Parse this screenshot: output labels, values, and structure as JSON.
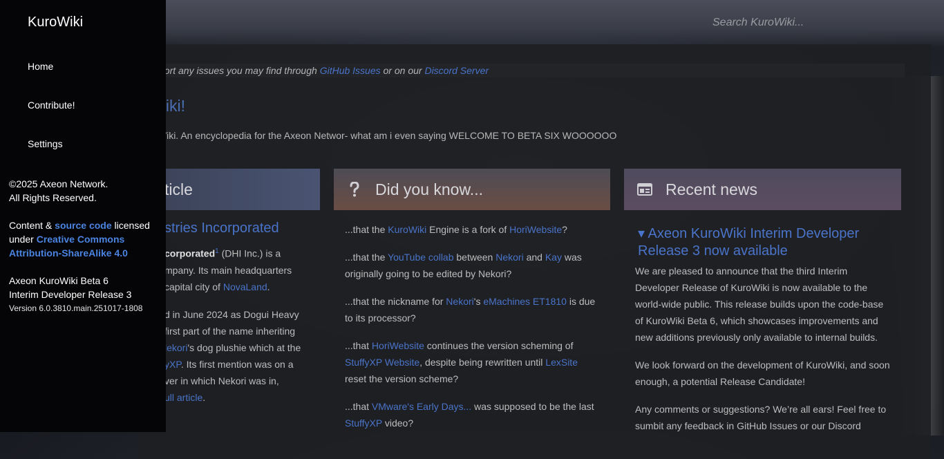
{
  "sidebar": {
    "brand": "KuroWiki",
    "nav": [
      "Home",
      "Contribute!",
      "Settings"
    ],
    "copyright_line1": "©2025 Axeon Network.",
    "copyright_line2": "All Rights Reserved.",
    "license_prefix": "Content & ",
    "license_source": "source code",
    "license_mid1": " licensed",
    "license_under": "under ",
    "license_cc1": "Creative Commons",
    "license_cc2": "Attribution-ShareAlike 4.0",
    "release_line1": "Axeon KuroWiki Beta 6",
    "release_line2": "Interim Developer Release 3",
    "version": "Version 6.0.3810.main.251017-1808"
  },
  "header": {
    "search_placeholder": "Search KuroWiki..."
  },
  "notice": {
    "prefix": "port any issues you may find through ",
    "link1": "GitHub Issues",
    "mid": " or on our ",
    "link2": "Discord Server"
  },
  "welcome": {
    "title": "Viki!",
    "text": "Viki. An encyclopedia for the Axeon Networ- what am i even saying WELCOME TO BETA SIX WOOOOOO"
  },
  "featured": {
    "header": "ticle",
    "title": "stries Incorporated",
    "p1_bold": "corporated",
    "p1_sup": "1",
    "p1_a": " (DHI Inc.) is a",
    "p1_b": "mpany. Its main headquarters",
    "p1_c": " capital city of ",
    "p1_link": "NovaLand",
    "p1_d": ".",
    "p2_a": "d in June 2024 as Dogui Heavy",
    "p2_b": " first part of the name inheriting",
    "p2_link1": "lekori",
    "p2_c": "'s dog plushie which at the",
    "p2_link2": "yXP",
    "p2_d": ". Its first mention was on a",
    "p2_e": "ver in which Nekori was in,",
    "p2_link3": "ull article",
    "p2_f": "."
  },
  "dyk": {
    "header": "Did you know...",
    "i1_a": "...that the ",
    "i1_l1": "KuroWiki",
    "i1_b": " Engine is a fork of ",
    "i1_l2": "HoriWebsite",
    "i1_c": "?",
    "i2_a": "...that the ",
    "i2_l1": "YouTube collab",
    "i2_b": " between ",
    "i2_l2": "Nekori",
    "i2_c": " and ",
    "i2_l3": "Kay",
    "i2_d": " was originally going to be edited by Nekori?",
    "i3_a": "...that the nickname for ",
    "i3_l1": "Nekori",
    "i3_b": "'s ",
    "i3_l2": "eMachines ET1810",
    "i3_c": " is due to its processor?",
    "i4_a": "...that ",
    "i4_l1": "HoriWebsite",
    "i4_b": " continues the version scheming of ",
    "i4_l2": "StuffyXP Website",
    "i4_c": ", despite being rewritten until ",
    "i4_l3": "LexSite",
    "i4_d": " reset the version scheme?",
    "i5_a": "...that ",
    "i5_l1": "VMware's Early Days...",
    "i5_b": " was supposed to be the last ",
    "i5_l2": "StuffyXP",
    "i5_c": " video?"
  },
  "news": {
    "header": "Recent news",
    "title": "▾ Axeon KuroWiki Interim Developer Release 3 now available",
    "p1": "We are pleased to announce that the third Interim Developer Release of KuroWiki is now available to the world-wide public. This release builds upon the code-base of KuroWiki Beta 6, which showcases improvements and new additions previously only available to internal builds.",
    "p2": "We look forward on the development of KuroWiki, and soon enough, a potential Release Candidate!",
    "p3": "Any comments or suggestions? We’re all ears! Feel free to sumbit any feedback in GitHub Issues or our Discord"
  },
  "colors": {
    "link": "#4a74c9",
    "sidebar_bg": "#050507"
  },
  "icons": [
    "question-icon",
    "news-icon"
  ]
}
